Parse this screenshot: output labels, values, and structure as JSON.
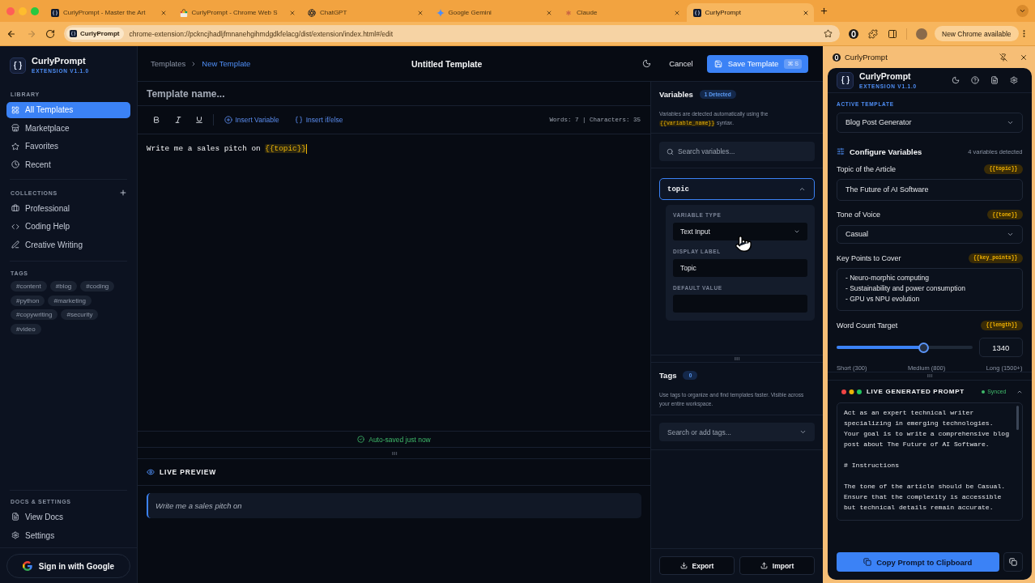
{
  "browser": {
    "tabs": [
      {
        "title": "CurlyPrompt - Master the Art",
        "selected": false
      },
      {
        "title": "CurlyPrompt - Chrome Web S",
        "selected": false
      },
      {
        "title": "ChatGPT",
        "selected": false
      },
      {
        "title": "Google Gemini",
        "selected": false
      },
      {
        "title": "Claude",
        "selected": false
      },
      {
        "title": "CurlyPrompt",
        "selected": true
      }
    ],
    "address": {
      "chip": "CurlyPrompt",
      "url": "chrome-extension://pckncjhadljfmnanehgihmdgdkfelacg/dist/extension/index.html#/edit"
    },
    "update_button": "New Chrome available"
  },
  "sidebar": {
    "brand": {
      "name": "CurlyPrompt",
      "version": "EXTENSION V1.1.0"
    },
    "sections": [
      {
        "title": "LIBRARY",
        "kind": "plain",
        "items": [
          {
            "label": "All Templates",
            "selected": true
          },
          {
            "label": "Marketplace",
            "selected": false
          },
          {
            "label": "Favorites",
            "selected": false
          },
          {
            "label": "Recent",
            "selected": false
          }
        ]
      },
      {
        "title": "COLLECTIONS",
        "kind": "addable",
        "items": [
          {
            "label": "Professional",
            "selected": false
          },
          {
            "label": "Coding Help",
            "selected": false
          },
          {
            "label": "Creative Writing",
            "selected": false
          }
        ]
      }
    ],
    "tags": {
      "title": "TAGS",
      "items": [
        "#content",
        "#blog",
        "#coding",
        "#python",
        "#marketing",
        "#copywriting",
        "#security",
        "#video"
      ]
    },
    "footer": {
      "title": "DOCS & SETTINGS",
      "items": [
        {
          "label": "View Docs",
          "selected": false
        },
        {
          "label": "Settings",
          "selected": false
        }
      ]
    },
    "sign_in": "Sign in with Google"
  },
  "header": {
    "breadcrumb": [
      {
        "label": "Templates",
        "current": false
      },
      {
        "label": "New Template",
        "current": true
      }
    ],
    "title": "Untitled Template",
    "cancel": "Cancel",
    "save": {
      "label": "Save Template",
      "shortcut": "⌘ S"
    }
  },
  "editor": {
    "name_placeholder": "Template name...",
    "toolbar": {
      "insert_variable": "Insert Variable",
      "insert_condition": "Insert if/else",
      "stats": "Words: 7 | Characters: 35"
    },
    "content": {
      "text": "Write me a sales pitch on ",
      "variable": "{{topic}}"
    },
    "autosave": "Auto-saved just now",
    "preview": {
      "title": "LIVE PREVIEW",
      "text": "Write me a sales pitch on"
    }
  },
  "variables_panel": {
    "title": "Variables",
    "badge": "1 Detected",
    "hint": {
      "before": "Variables are detected automatically using the ",
      "code": "{{variable_name}}",
      "after": " syntax."
    },
    "search_placeholder": "Search variables...",
    "variables": [
      {
        "name": "topic",
        "expanded": true,
        "fields": [
          {
            "kind": "select",
            "label": "VARIABLE TYPE",
            "value": "Text Input"
          },
          {
            "kind": "text",
            "label": "DISPLAY LABEL",
            "value": "Topic"
          },
          {
            "kind": "text",
            "label": "DEFAULT VALUE"
          }
        ]
      }
    ],
    "tags": {
      "title": "Tags",
      "count": "0",
      "hint": "Use tags to organize and find templates faster. Visible across your entire workspace.",
      "placeholder": "Search or add tags..."
    },
    "actions": [
      "Export",
      "Import"
    ]
  },
  "side_panel": {
    "title": "CurlyPrompt",
    "brand": {
      "name": "CurlyPrompt",
      "version": "EXTENSION V1.1.0"
    },
    "active_template": {
      "label": "ACTIVE TEMPLATE",
      "value": "Blog Post Generator"
    },
    "configure": {
      "title": "Configure Variables",
      "count": "4 variables detected"
    },
    "fields": [
      {
        "kind": "text",
        "label": "Topic of the Article",
        "token": "{{topic}}",
        "value": "The Future of AI Software"
      },
      {
        "kind": "select",
        "label": "Tone of Voice",
        "token": "{{tone}}",
        "value": "Casual"
      },
      {
        "kind": "textarea",
        "label": "Key Points to Cover",
        "token": "{{key_points}}",
        "value": "- Neuro-morphic computing\n- Sustainability and power consumption\n- GPU vs NPU evolution"
      },
      {
        "kind": "slider",
        "label": "Word Count Target",
        "token": "{{length}}",
        "level": 0.64,
        "value": "1340",
        "marks": [
          "Short (300)",
          "Medium (800)",
          "Long (1500+)"
        ]
      }
    ],
    "prompt": {
      "title": "LIVE GENERATED PROMPT",
      "status": "Synced",
      "expanded": true,
      "text": "Act as an expert technical writer specializing in emerging technologies. Your goal is to write a comprehensive blog post about The Future of AI Software.\n\n# Instructions\n\nThe tone of the article should be Casual. Ensure that the complexity is accessible but technical details remain accurate."
    },
    "copy_button": "Copy Prompt to Clipboard"
  }
}
